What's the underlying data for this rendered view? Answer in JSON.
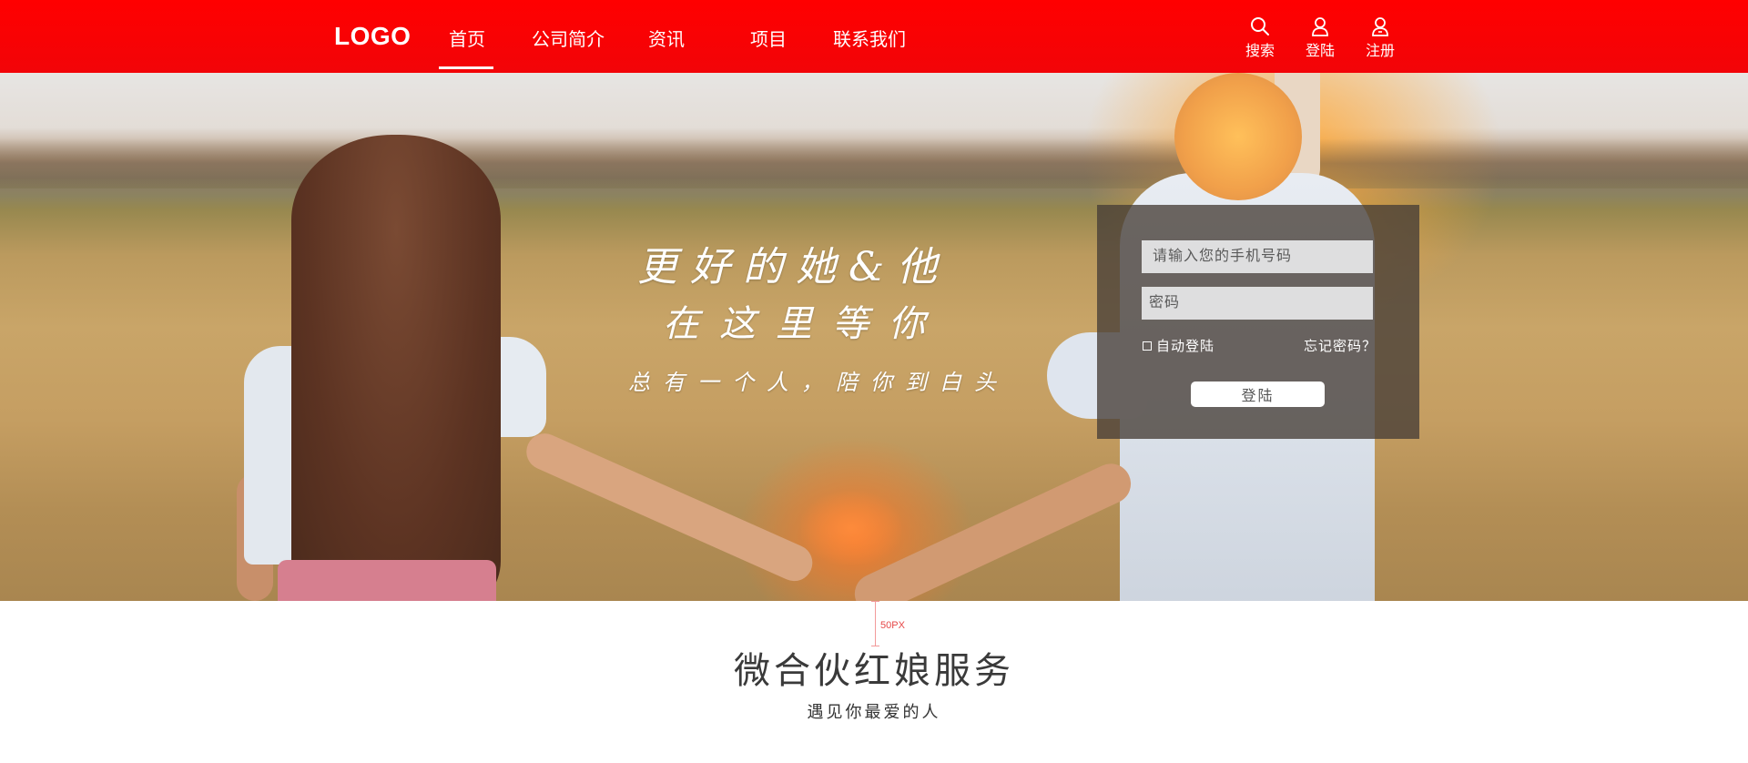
{
  "header": {
    "logo": "LOGO",
    "nav": [
      {
        "label": "首页",
        "active": true
      },
      {
        "label": "公司简介"
      },
      {
        "label": "资讯"
      },
      {
        "label": "项目"
      },
      {
        "label": "联系我们"
      }
    ],
    "actions": {
      "search": {
        "label": "搜索",
        "icon": "search-icon"
      },
      "login": {
        "label": "登陆",
        "icon": "user-icon"
      },
      "register": {
        "label": "注册",
        "icon": "user-add-icon"
      }
    },
    "colors": {
      "background": "#ff0000",
      "text": "#ffffff"
    }
  },
  "hero": {
    "line1": "更好的她&他",
    "line2": "在这里等你",
    "line3": "总有一个人，陪你到白头"
  },
  "login": {
    "phone_placeholder": "请输入您的手机号码",
    "password_placeholder": "密码",
    "auto_login_label": "自动登陆",
    "forgot_label": "忘记密码？",
    "submit_label": "登陆"
  },
  "section": {
    "spacing_note": "50PX",
    "title": "微合伙红娘服务",
    "subtitle": "遇见你最爱的人"
  }
}
